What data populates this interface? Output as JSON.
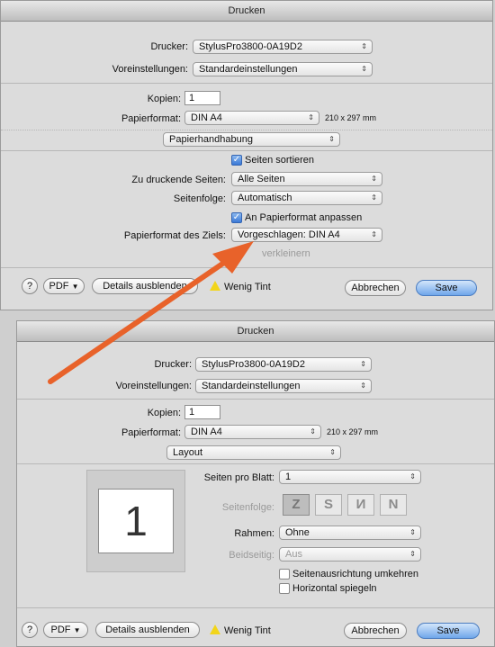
{
  "dialog1": {
    "title": "Drucken",
    "printer_label": "Drucker:",
    "printer_value": "StylusPro3800-0A19D2",
    "presets_label": "Voreinstellungen:",
    "presets_value": "Standardeinstellungen",
    "copies_label": "Kopien:",
    "copies_value": "1",
    "paper_label": "Papierformat:",
    "paper_value": "DIN A4",
    "paper_size": "210 x 297 mm",
    "section_value": "Papierhandhabung",
    "collate_label": "Seiten sortieren",
    "pages_label": "Zu druckende Seiten:",
    "pages_value": "Alle Seiten",
    "order_label": "Seitenfolge:",
    "order_value": "Automatisch",
    "fit_label": "An Papierformat anpassen",
    "dest_label": "Papierformat des Ziels:",
    "dest_value": "Vorgeschlagen: DIN A4",
    "shrink_label": "verkleinern",
    "pdf_label": "PDF",
    "details_label": "Details ausblenden",
    "ink_label": "Wenig Tint",
    "cancel_label": "Abbrechen",
    "save_label": "Save"
  },
  "dialog2": {
    "title": "Drucken",
    "printer_label": "Drucker:",
    "printer_value": "StylusPro3800-0A19D2",
    "presets_label": "Voreinstellungen:",
    "presets_value": "Standardeinstellungen",
    "copies_label": "Kopien:",
    "copies_value": "1",
    "paper_label": "Papierformat:",
    "paper_value": "DIN A4",
    "paper_size": "210 x 297 mm",
    "section_value": "Layout",
    "preview_page": "1",
    "pps_label": "Seiten pro Blatt:",
    "pps_value": "1",
    "order_label": "Seitenfolge:",
    "layout_dirs": [
      "Z",
      "S",
      "И",
      "N"
    ],
    "border_label": "Rahmen:",
    "border_value": "Ohne",
    "duplex_label": "Beidseitig:",
    "duplex_value": "Aus",
    "reverse_label": "Seitenausrichtung umkehren",
    "flip_label": "Horizontal spiegeln",
    "pdf_label": "PDF",
    "details_label": "Details ausblenden",
    "ink_label": "Wenig Tint",
    "cancel_label": "Abbrechen",
    "save_label": "Save"
  },
  "colors": {
    "arrow": "#e8622a",
    "accent": "#3a78d6"
  }
}
